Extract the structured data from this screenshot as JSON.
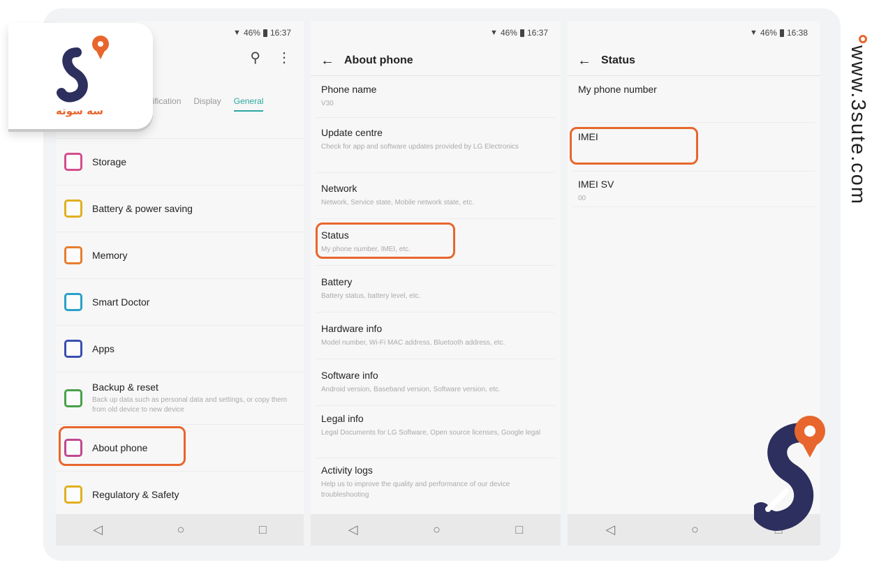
{
  "status_bars": [
    {
      "battery": "46%",
      "time": "16:37"
    },
    {
      "battery": "46%",
      "time": "16:37"
    },
    {
      "battery": "46%",
      "time": "16:38"
    }
  ],
  "settings": {
    "tabs": [
      "Notification",
      "Display",
      "General"
    ],
    "active_tab": "General",
    "items": [
      {
        "label": "Storage",
        "color": "#d44c8c"
      },
      {
        "label": "Battery & power saving",
        "color": "#e0b020"
      },
      {
        "label": "Memory",
        "color": "#e87d2d"
      },
      {
        "label": "Smart Doctor",
        "color": "#2aa0c8"
      },
      {
        "label": "Apps",
        "color": "#3a4fb0"
      },
      {
        "label": "Backup & reset",
        "sub": "Back up data such as personal data and settings, or copy them from old device to new device",
        "color": "#4aa04a"
      },
      {
        "label": "About phone",
        "color": "#c04890"
      },
      {
        "label": "Regulatory & Safety",
        "color": "#e0b020"
      }
    ]
  },
  "about": {
    "title": "About phone",
    "items": [
      {
        "title": "Phone name",
        "sub": "V30"
      },
      {
        "title": "Update centre",
        "sub": "Check for app and software updates provided by LG Electronics"
      },
      {
        "title": "Network",
        "sub": "Network, Service state, Mobile network state, etc."
      },
      {
        "title": "Status",
        "sub": "My phone number, IMEI, etc."
      },
      {
        "title": "Battery",
        "sub": "Battery status, battery level, etc."
      },
      {
        "title": "Hardware info",
        "sub": "Model number, Wi-Fi MAC address, Bluetooth address, etc."
      },
      {
        "title": "Software info",
        "sub": "Android version, Baseband version, Software version, etc."
      },
      {
        "title": "Legal info",
        "sub": "Legal Documents for LG Software, Open source licenses, Google legal"
      },
      {
        "title": "Activity logs",
        "sub": "Help us to improve the quality and performance of our device troubleshooting"
      }
    ]
  },
  "status": {
    "title": "Status",
    "items": [
      {
        "title": "My phone number",
        "sub": ""
      },
      {
        "title": "IMEI",
        "sub": ""
      },
      {
        "title": "IMEI SV",
        "sub": "00"
      }
    ]
  },
  "watermark": {
    "site": "www.3sute.com",
    "logo_text": "سه سوته"
  },
  "colors": {
    "accent": "#e8662d",
    "tab_active": "#2aa7a0",
    "brand_dark": "#2d2f5e"
  }
}
